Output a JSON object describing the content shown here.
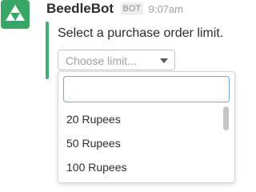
{
  "message": {
    "bot_name": "BeedleBot",
    "badge": "BOT",
    "time": "9:07am",
    "text": "Select a purchase order limit."
  },
  "select": {
    "value": "Choose limit...",
    "search_placeholder": "",
    "options": [
      "20 Rupees",
      "50 Rupees",
      "100 Rupees"
    ]
  },
  "colors": {
    "avatar": "#3aa564",
    "accent": "#3fb16c",
    "focus": "#74a6d8"
  },
  "icons": {
    "avatar": "triforce-icon",
    "caret": "chevron-down-icon"
  }
}
